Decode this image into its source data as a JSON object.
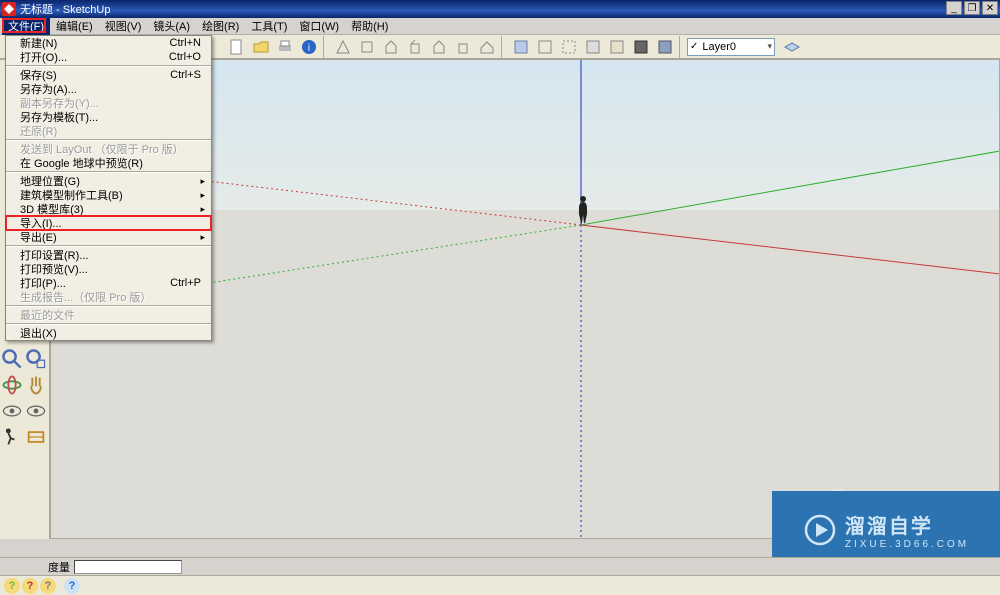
{
  "app": {
    "title": "无标题 - SketchUp"
  },
  "window_buttons": {
    "min": "_",
    "max": "❐",
    "close": "✕"
  },
  "menubar": {
    "items": [
      "文件(F)",
      "编辑(E)",
      "视图(V)",
      "镜头(A)",
      "绘图(R)",
      "工具(T)",
      "窗口(W)",
      "帮助(H)"
    ],
    "active_index": 0
  },
  "file_menu": {
    "groups": [
      [
        {
          "label": "新建(N)",
          "shortcut": "Ctrl+N"
        },
        {
          "label": "打开(O)...",
          "shortcut": "Ctrl+O"
        }
      ],
      [
        {
          "label": "保存(S)",
          "shortcut": "Ctrl+S"
        },
        {
          "label": "另存为(A)..."
        },
        {
          "label": "副本另存为(Y)...",
          "disabled": true
        },
        {
          "label": "另存为模板(T)..."
        },
        {
          "label": "还原(R)",
          "disabled": true
        }
      ],
      [
        {
          "label": "发送到 LayOut （仅限于 Pro 版）",
          "disabled": true
        },
        {
          "label": "在 Google 地球中预览(R)"
        }
      ],
      [
        {
          "label": "地理位置(G)",
          "submenu": true
        },
        {
          "label": "建筑模型制作工具(B)",
          "submenu": true
        },
        {
          "label": "3D 模型库(3)",
          "submenu": true
        },
        {
          "label": "导入(I)...",
          "highlight": true
        },
        {
          "label": "导出(E)",
          "submenu": true
        }
      ],
      [
        {
          "label": "打印设置(R)..."
        },
        {
          "label": "打印预览(V)..."
        },
        {
          "label": "打印(P)...",
          "shortcut": "Ctrl+P"
        },
        {
          "label": "生成报告...（仅限 Pro 版）",
          "disabled": true
        }
      ],
      [
        {
          "label": "最近的文件",
          "disabled": true
        }
      ],
      [
        {
          "label": "退出(X)"
        }
      ]
    ]
  },
  "layer": {
    "current": "Layer0"
  },
  "status": {
    "measure_label": "度量"
  },
  "watermark": {
    "line1": "溜溜自学",
    "line2": "ZIXUE.3D66.COM"
  },
  "colors": {
    "accent": "#2c73b1",
    "axis_red": "#d45b5b",
    "axis_green": "#4bbf4b",
    "axis_blue": "#1a2fb8"
  }
}
